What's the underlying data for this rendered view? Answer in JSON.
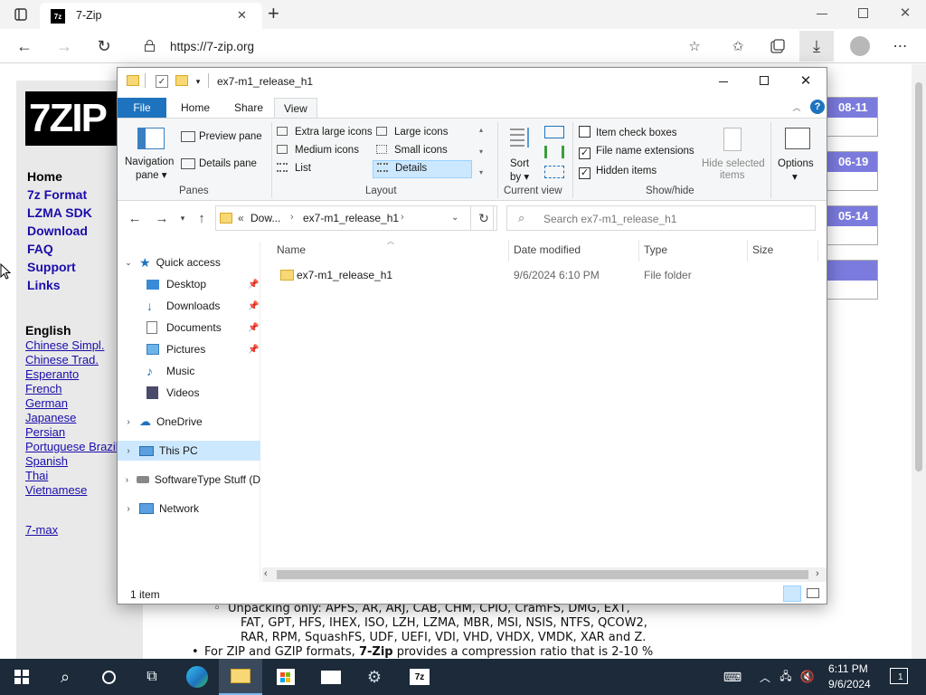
{
  "browser": {
    "tab_title": "7-Zip",
    "url": "https://7-zip.org",
    "new_tab": "+",
    "tab_close": "✕"
  },
  "site": {
    "logo_text": "7ZIP",
    "nav": [
      "Home",
      "7z Format",
      "LZMA SDK",
      "Download",
      "FAQ",
      "Support",
      "Links"
    ],
    "lang_heading": "English",
    "languages": [
      "Chinese Simpl.",
      "Chinese Trad.",
      "Esperanto",
      "French",
      "German",
      "Japanese",
      "Persian",
      "Portuguese Brazil",
      "Spanish",
      "Thai",
      "Vietnamese"
    ],
    "seven_max": "7-max",
    "date_badges": [
      "08-11",
      "06-19",
      "05-14"
    ],
    "body_lines": [
      "Unpacking only: APFS, AR, ARJ, CAB, CHM, CPIO, CramFS, DMG, EXT,",
      "FAT, GPT, HFS, IHEX, ISO, LZH, LZMA, MBR, MSI, NSIS, NTFS, QCOW2,",
      "RAR, RPM, SquashFS, UDF, UEFI, VDI, VHD, VHDX, VMDK, XAR and Z."
    ],
    "body_last": {
      "pre": "For ZIP and GZIP formats, ",
      "bold": "7-Zip",
      "post": " provides a compression ratio that is 2-10 %"
    }
  },
  "explorer": {
    "title": "ex7-m1_release_h1",
    "ribbon_tabs": [
      "File",
      "Home",
      "Share",
      "View"
    ],
    "panes": {
      "navigation_pane": "Navigation",
      "navigation_pane2": "pane",
      "preview_pane": "Preview pane",
      "details_pane": "Details pane",
      "group": "Panes"
    },
    "layout": {
      "items": [
        "Extra large icons",
        "Large icons",
        "Medium icons",
        "Small icons",
        "List",
        "Details"
      ],
      "group": "Layout"
    },
    "current_view": {
      "sort": "Sort",
      "sort2": "by",
      "group": "Current view"
    },
    "show_hide": {
      "item_check_boxes": "Item check boxes",
      "file_name_extensions": "File name extensions",
      "hidden_items": "Hidden items",
      "hide_selected": "Hide selected",
      "hide_selected2": "items",
      "group": "Show/hide"
    },
    "options": "Options",
    "breadcrumb": {
      "prefix": "«",
      "part1": "Dow...",
      "part2": "ex7-m1_release_h1"
    },
    "search_placeholder": "Search ex7-m1_release_h1",
    "columns": [
      "Name",
      "Date modified",
      "Type",
      "Size"
    ],
    "files": [
      {
        "name": "ex7-m1_release_h1",
        "date": "9/6/2024 6:10 PM",
        "type": "File folder",
        "size": ""
      }
    ],
    "nav": {
      "quick_access": "Quick access",
      "quick_items": [
        "Desktop",
        "Downloads",
        "Documents",
        "Pictures",
        "Music",
        "Videos"
      ],
      "onedrive": "OneDrive",
      "this_pc": "This PC",
      "software": "SoftwareType Stuff (D",
      "network": "Network"
    },
    "status": "1 item"
  },
  "taskbar": {
    "time": "6:11 PM",
    "date": "9/6/2024",
    "notification_count": "1"
  },
  "colors": {
    "accent": "#1e73be",
    "selection": "#cce8ff",
    "taskbar": "#1c2a3a",
    "badge": "#7b7bde"
  }
}
